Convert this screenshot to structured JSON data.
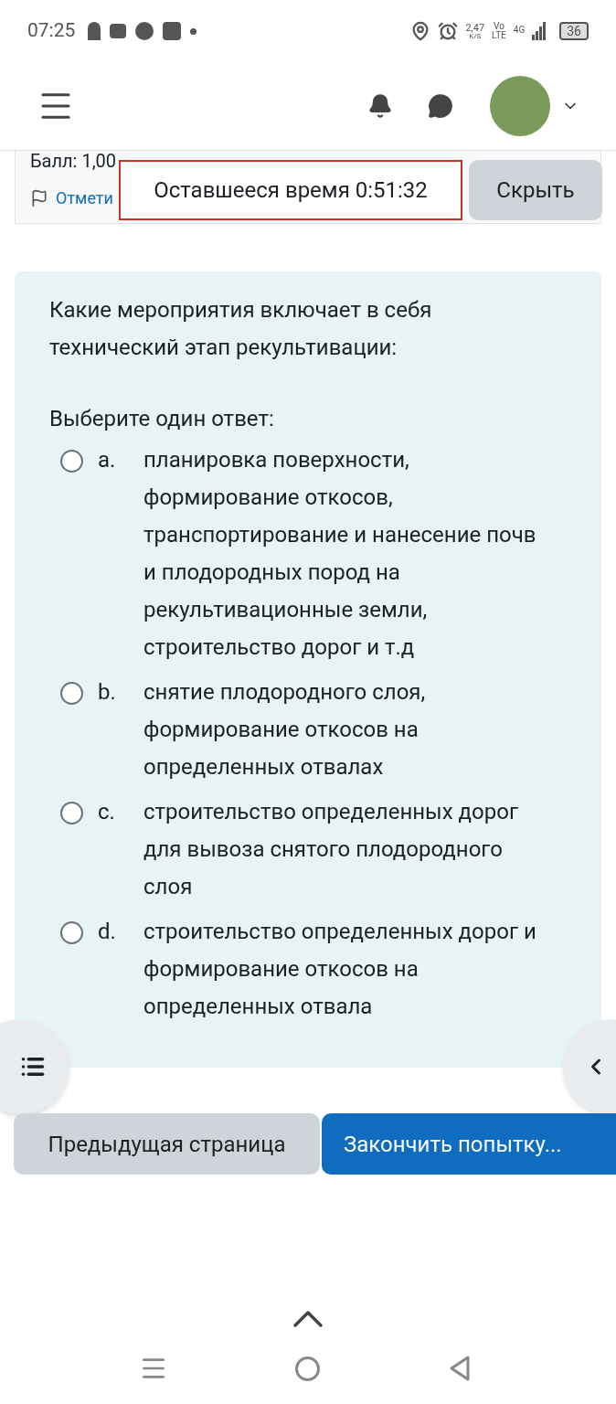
{
  "status_bar": {
    "time": "07:25",
    "net_speed": "2,47",
    "net_unit": "K/S",
    "volte_top": "Vo",
    "volte_bottom": "LTE",
    "network": "4G",
    "battery": "36"
  },
  "question_info": {
    "score": "Балл: 1,00",
    "flag_link": "Отмети"
  },
  "timer": {
    "text": "Оставшееся время 0:51:32",
    "hide_button": "Скрыть"
  },
  "question": {
    "text": "Какие мероприятия включает в себя технический этап рекультивации:",
    "prompt": "Выберите один ответ:",
    "options": [
      {
        "letter": "a.",
        "text": "планировка поверхности, формирование откосов, транспортирование и нанесение почв и плодородных пород на рекультивационные земли, строительство дорог и т.д",
        "selected": false
      },
      {
        "letter": "b.",
        "text": "снятие плодородного слоя, формирование откосов на определенных отвалах",
        "selected": false
      },
      {
        "letter": "c.",
        "text": "строительство определенных дорог для вывоза снятого плодородного слоя",
        "selected": false
      },
      {
        "letter": "d.",
        "text": "строительство определенных дорог и формирование откосов на определенных отвала",
        "selected": false
      }
    ]
  },
  "buttons": {
    "previous": "Предыдущая страница",
    "finish": "Закончить попытку..."
  }
}
